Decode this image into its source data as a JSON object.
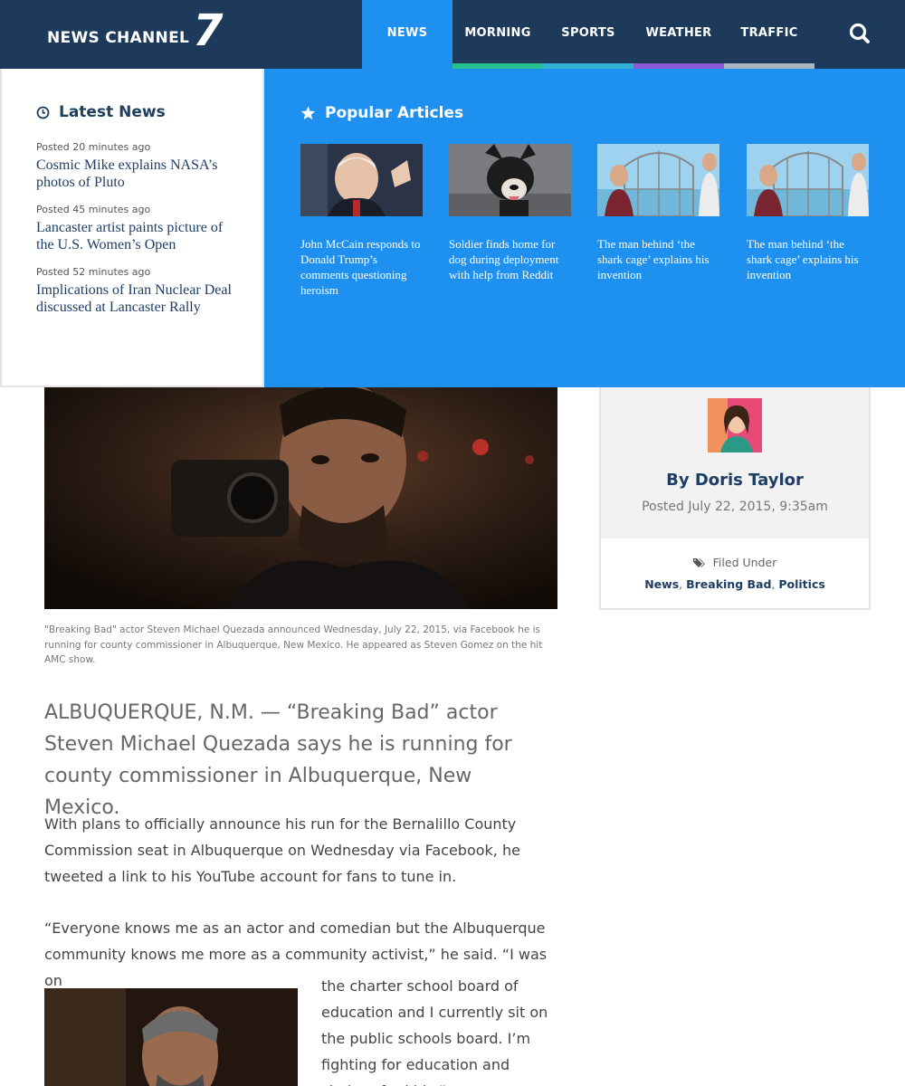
{
  "header": {
    "logo_text": "NEWS CHANNEL",
    "logo_number": "7",
    "nav": [
      {
        "label": "NEWS",
        "color": "#1e90f0",
        "active": true
      },
      {
        "label": "MORNING",
        "color": "#27bf8a"
      },
      {
        "label": "SPORTS",
        "color": "#30b1d4"
      },
      {
        "label": "WEATHER",
        "color": "#8b5bd6"
      },
      {
        "label": "TRAFFIC",
        "color": "#a8b4c0"
      }
    ],
    "search_icon": "search-icon",
    "background": "#1d3a5a"
  },
  "dropdown": {
    "latest": {
      "heading": "Latest News",
      "icon": "clock-icon",
      "items": [
        {
          "time": "Posted 20 minutes ago",
          "title": "Cosmic Mike explains NASA’s photos of Pluto"
        },
        {
          "time": "Posted 45 minutes ago",
          "title": "Lancaster artist paints picture of the U.S. Women’s Open"
        },
        {
          "time": "Posted 52 minutes ago",
          "title": "Implications of Iran Nuclear Deal discussed at Lancaster Rally"
        }
      ]
    },
    "popular": {
      "heading": "Popular Articles",
      "icon": "star-icon",
      "background": "#1e90f0",
      "items": [
        {
          "title": "John McCain responds to Donald Trump’s comments questioning heroism"
        },
        {
          "title": "Soldier finds home for dog during deployment with help from Reddit"
        },
        {
          "title": "The man behind ‘the shark cage’ explains his invention"
        },
        {
          "title": "The man behind ‘the shark cage’ explains his invention"
        }
      ]
    }
  },
  "article": {
    "caption": "\"Breaking Bad\" actor Steven Michael Quezada announced Wednesday, July 22, 2015, via Facebook he is running for county commissioner in Albuquerque, New Mexico. He appeared as Steven Gomez on the hit AMC show.",
    "lede": "ALBUQUERQUE, N.M. — “Breaking Bad” actor Steven Michael Quezada says he is running for county commissioner in Albuquerque, New Mexico.",
    "paragraph1": "With plans to officially announce his run for the Bernalillo County Commission seat in Albuquerque on Wednesday via Facebook, he tweeted a link to his YouTube account for fans to tune in.",
    "paragraph2": "“Everyone knows me as an actor and comedian but the Albuquerque community knows me more as a community activist,” he said. “I was on",
    "paragraph3": "the charter school board of education and I currently sit on the public schools board. I’m fighting for education and choices for kids.”"
  },
  "sidebar": {
    "author": "By Doris Taylor",
    "posted": "Posted July 22, 2015, 9:35am",
    "filed_label": "Filed Under",
    "filed_icon": "tags-icon",
    "tags": [
      "News",
      "Breaking Bad",
      "Politics"
    ]
  }
}
